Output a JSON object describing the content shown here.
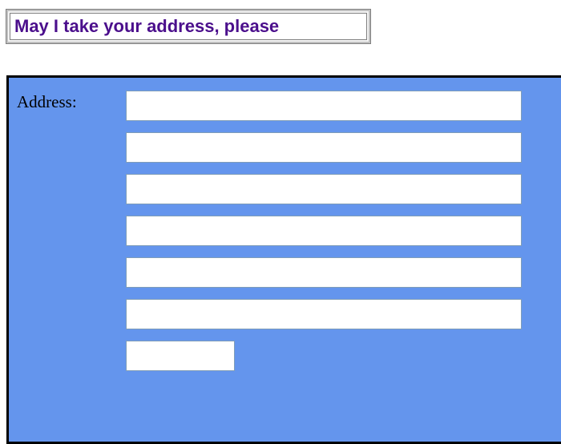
{
  "header": {
    "title": "May I take your address, please"
  },
  "form": {
    "address_label": "Address:",
    "fields": [
      {
        "value": "",
        "placeholder": ""
      },
      {
        "value": "",
        "placeholder": ""
      },
      {
        "value": "",
        "placeholder": ""
      },
      {
        "value": "",
        "placeholder": ""
      },
      {
        "value": "",
        "placeholder": ""
      },
      {
        "value": "",
        "placeholder": ""
      },
      {
        "value": "",
        "placeholder": ""
      }
    ],
    "panel_color": "#6495ED",
    "title_color": "#4B0F8C"
  }
}
